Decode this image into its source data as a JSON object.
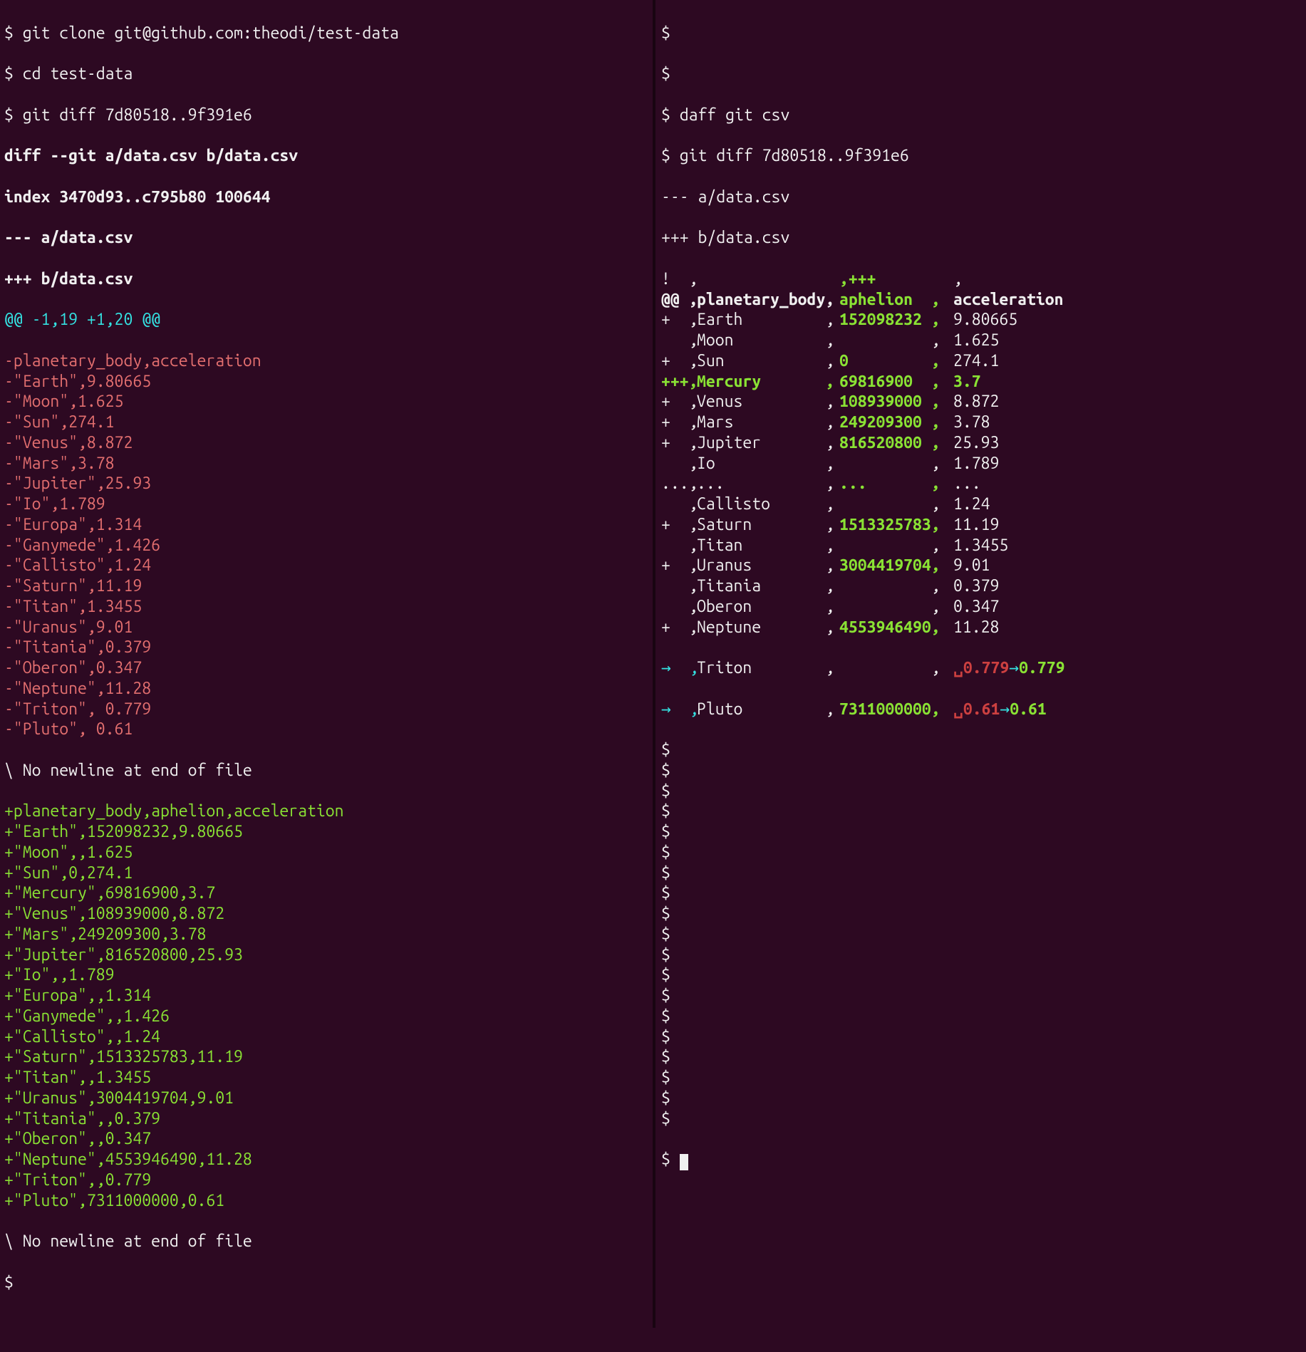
{
  "left": {
    "cmd1": "$ git clone git@github.com:theodi/test-data",
    "cmd2": "$ cd test-data",
    "cmd3": "$ git diff 7d80518..9f391e6",
    "hdr_diff": "diff --git a/data.csv b/data.csv",
    "hdr_index": "index 3470d93..c795b80 100644",
    "hdr_minus": "--- a/data.csv",
    "hdr_plus": "+++ b/data.csv",
    "hunk": "@@ -1,19 +1,20 @@",
    "removed": [
      "-planetary_body,acceleration",
      "-\"Earth\",9.80665",
      "-\"Moon\",1.625",
      "-\"Sun\",274.1",
      "-\"Venus\",8.872",
      "-\"Mars\",3.78",
      "-\"Jupiter\",25.93",
      "-\"Io\",1.789",
      "-\"Europa\",1.314",
      "-\"Ganymede\",1.426",
      "-\"Callisto\",1.24",
      "-\"Saturn\",11.19",
      "-\"Titan\",1.3455",
      "-\"Uranus\",9.01",
      "-\"Titania\",0.379",
      "-\"Oberon\",0.347",
      "-\"Neptune\",11.28",
      "-\"Triton\", 0.779",
      "-\"Pluto\", 0.61"
    ],
    "nonewline1": "\\ No newline at end of file",
    "added": [
      "+planetary_body,aphelion,acceleration",
      "+\"Earth\",152098232,9.80665",
      "+\"Moon\",,1.625",
      "+\"Sun\",0,274.1",
      "+\"Mercury\",69816900,3.7",
      "+\"Venus\",108939000,8.872",
      "+\"Mars\",249209300,3.78",
      "+\"Jupiter\",816520800,25.93",
      "+\"Io\",,1.789",
      "+\"Europa\",,1.314",
      "+\"Ganymede\",,1.426",
      "+\"Callisto\",,1.24",
      "+\"Saturn\",1513325783,11.19",
      "+\"Titan\",,1.3455",
      "+\"Uranus\",3004419704,9.01",
      "+\"Titania\",,0.379",
      "+\"Oberon\",,0.347",
      "+\"Neptune\",4553946490,11.28",
      "+\"Triton\",,0.779",
      "+\"Pluto\",7311000000,0.61"
    ],
    "nonewline2": "\\ No newline at end of file",
    "prompt": "$"
  },
  "right": {
    "cmd0": "$",
    "cmd1": "$",
    "cmd2": "$ daff git csv",
    "cmd3": "$ git diff 7d80518..9f391e6",
    "hdr_minus": "--- a/data.csv",
    "hdr_plus": "+++ b/data.csv",
    "cols": {
      "c0w": "50px",
      "c1w": "200px",
      "c2w": "160px",
      "c3w": "auto"
    },
    "rows": [
      {
        "c0": "!  ,",
        "c1": "",
        "c2": ",+++",
        "c3": ",",
        "style": {
          "c0": "white",
          "c1": "white",
          "c2": "green bold",
          "c3": "white"
        }
      },
      {
        "c0": "@@ ,",
        "c1": "planetary_body,",
        "c2": "aphelion  ,",
        "c3": "acceleration",
        "style": {
          "c0": "white bold",
          "c1": "white bold",
          "c2": "green bold",
          "c3": "white bold"
        }
      },
      {
        "c0": "+  ,",
        "c1": "Earth         ,",
        "c2": "152098232 ,",
        "c3": "9.80665",
        "style": {
          "c0": "white",
          "c1": "white",
          "c2": "green bold",
          "c3": "white"
        }
      },
      {
        "c0": "   ,",
        "c1": "Moon          ,",
        "c2": "          ,",
        "c3": "1.625",
        "style": {
          "c0": "white",
          "c1": "white",
          "c2": "white",
          "c3": "white"
        }
      },
      {
        "c0": "+  ,",
        "c1": "Sun           ,",
        "c2": "0         ,",
        "c3": "274.1",
        "style": {
          "c0": "white",
          "c1": "white",
          "c2": "green bold",
          "c3": "white"
        }
      },
      {
        "c0": "+++,",
        "c1": "Mercury       ,",
        "c2": "69816900  ,",
        "c3": "3.7",
        "style": {
          "c0": "green bold",
          "c1": "green bold",
          "c2": "green bold",
          "c3": "green bold"
        }
      },
      {
        "c0": "+  ,",
        "c1": "Venus         ,",
        "c2": "108939000 ,",
        "c3": "8.872",
        "style": {
          "c0": "white",
          "c1": "white",
          "c2": "green bold",
          "c3": "white"
        }
      },
      {
        "c0": "+  ,",
        "c1": "Mars          ,",
        "c2": "249209300 ,",
        "c3": "3.78",
        "style": {
          "c0": "white",
          "c1": "white",
          "c2": "green bold",
          "c3": "white"
        }
      },
      {
        "c0": "+  ,",
        "c1": "Jupiter       ,",
        "c2": "816520800 ,",
        "c3": "25.93",
        "style": {
          "c0": "white",
          "c1": "white",
          "c2": "green bold",
          "c3": "white"
        }
      },
      {
        "c0": "   ,",
        "c1": "Io            ,",
        "c2": "          ,",
        "c3": "1.789",
        "style": {
          "c0": "white",
          "c1": "white",
          "c2": "white",
          "c3": "white"
        }
      },
      {
        "c0": "...,",
        "c1": "...           ,",
        "c2": "...       ,",
        "c3": "...",
        "style": {
          "c0": "white",
          "c1": "white",
          "c2": "green bold",
          "c3": "white"
        }
      },
      {
        "c0": "   ,",
        "c1": "Callisto      ,",
        "c2": "          ,",
        "c3": "1.24",
        "style": {
          "c0": "white",
          "c1": "white",
          "c2": "white",
          "c3": "white"
        }
      },
      {
        "c0": "+  ,",
        "c1": "Saturn        ,",
        "c2": "1513325783,",
        "c3": "11.19",
        "style": {
          "c0": "white",
          "c1": "white",
          "c2": "green bold",
          "c3": "white"
        }
      },
      {
        "c0": "   ,",
        "c1": "Titan         ,",
        "c2": "          ,",
        "c3": "1.3455",
        "style": {
          "c0": "white",
          "c1": "white",
          "c2": "white",
          "c3": "white"
        }
      },
      {
        "c0": "+  ,",
        "c1": "Uranus        ,",
        "c2": "3004419704,",
        "c3": "9.01",
        "style": {
          "c0": "white",
          "c1": "white",
          "c2": "green bold",
          "c3": "white"
        }
      },
      {
        "c0": "   ,",
        "c1": "Titania       ,",
        "c2": "          ,",
        "c3": "0.379",
        "style": {
          "c0": "white",
          "c1": "white",
          "c2": "white",
          "c3": "white"
        }
      },
      {
        "c0": "   ,",
        "c1": "Oberon        ,",
        "c2": "          ,",
        "c3": "0.347",
        "style": {
          "c0": "white",
          "c1": "white",
          "c2": "white",
          "c3": "white"
        }
      },
      {
        "c0": "+  ,",
        "c1": "Neptune       ,",
        "c2": "4553946490,",
        "c3": "11.28",
        "style": {
          "c0": "white",
          "c1": "white",
          "c2": "green bold",
          "c3": "white"
        }
      }
    ],
    "triton": {
      "c0": "→  ,",
      "c1": "Triton        ,",
      "c2": "          ,",
      "old": "␣0.779",
      "arrow": "→",
      "new": "0.779"
    },
    "pluto": {
      "c0": "→  ,",
      "c1": "Pluto         ,",
      "c2": "7311000000,",
      "old": "␣0.61",
      "arrow": "→",
      "new": "0.61"
    },
    "trailing_prompts": 19,
    "prompt": "$"
  },
  "chart_data": {
    "type": "table",
    "title": "daff-style CSV diff of data.csv",
    "columns": [
      "planetary_body",
      "aphelion",
      "acceleration"
    ],
    "added_column": "aphelion",
    "rows_new_version": [
      {
        "planetary_body": "Earth",
        "aphelion": 152098232,
        "acceleration": 9.80665
      },
      {
        "planetary_body": "Moon",
        "aphelion": null,
        "acceleration": 1.625
      },
      {
        "planetary_body": "Sun",
        "aphelion": 0,
        "acceleration": 274.1
      },
      {
        "planetary_body": "Mercury",
        "aphelion": 69816900,
        "acceleration": 3.7
      },
      {
        "planetary_body": "Venus",
        "aphelion": 108939000,
        "acceleration": 8.872
      },
      {
        "planetary_body": "Mars",
        "aphelion": 249209300,
        "acceleration": 3.78
      },
      {
        "planetary_body": "Jupiter",
        "aphelion": 816520800,
        "acceleration": 25.93
      },
      {
        "planetary_body": "Io",
        "aphelion": null,
        "acceleration": 1.789
      },
      {
        "planetary_body": "Europa",
        "aphelion": null,
        "acceleration": 1.314
      },
      {
        "planetary_body": "Ganymede",
        "aphelion": null,
        "acceleration": 1.426
      },
      {
        "planetary_body": "Callisto",
        "aphelion": null,
        "acceleration": 1.24
      },
      {
        "planetary_body": "Saturn",
        "aphelion": 1513325783,
        "acceleration": 11.19
      },
      {
        "planetary_body": "Titan",
        "aphelion": null,
        "acceleration": 1.3455
      },
      {
        "planetary_body": "Uranus",
        "aphelion": 3004419704,
        "acceleration": 9.01
      },
      {
        "planetary_body": "Titania",
        "aphelion": null,
        "acceleration": 0.379
      },
      {
        "planetary_body": "Oberon",
        "aphelion": null,
        "acceleration": 0.347
      },
      {
        "planetary_body": "Neptune",
        "aphelion": 4553946490,
        "acceleration": 11.28
      },
      {
        "planetary_body": "Triton",
        "aphelion": null,
        "acceleration": 0.779
      },
      {
        "planetary_body": "Pluto",
        "aphelion": 7311000000,
        "acceleration": 0.61
      }
    ],
    "inserted_rows": [
      "Mercury"
    ],
    "cell_changes": [
      {
        "row": "Triton",
        "column": "acceleration",
        "old": " 0.779",
        "new": "0.779"
      },
      {
        "row": "Pluto",
        "column": "acceleration",
        "old": " 0.61",
        "new": "0.61"
      }
    ]
  }
}
